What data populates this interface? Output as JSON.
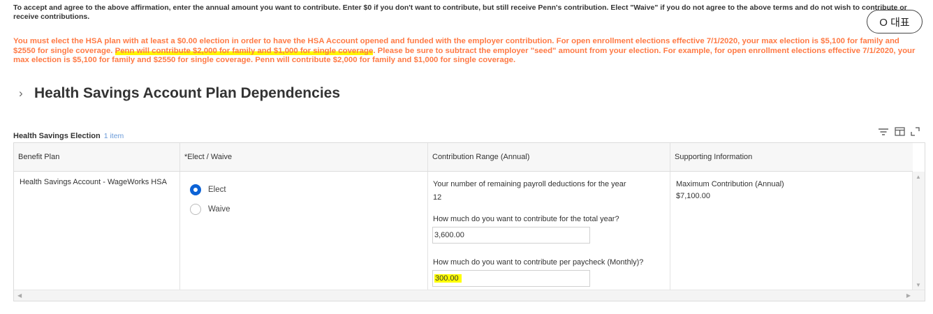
{
  "intro_text": "To accept and agree to the above affirmation, enter the annual amount you want to contribute.  Enter $0 if you don't want to contribute, but still receive Penn's contribution.  Elect \"Waive\" if you do not agree to the above terms and do not wish to contribute or receive contributions.",
  "warning": {
    "part1": "You must elect the HSA plan with at least a $0.00 election in order to have the HSA Account opened and funded with the employer contribution. For open enrollment elections effective 7/1/2020, your max election is $5,100 for family and $2550 for single coverage. ",
    "highlight": "Penn will contribute $2,000 for family and $1,000 for single coverage",
    "part2": ". Please be sure to subtract the employer \"seed\" amount from your election. For example, for open enrollment elections effective 7/1/2020, your max election is $5,100 for family and $2550 for single coverage. Penn will contribute $2,000 for family and $1,000 for single coverage."
  },
  "translate_button": "O 대표",
  "section_title": "Health Savings Account Plan Dependencies",
  "grid": {
    "title": "Health Savings Election",
    "count": "1 item",
    "columns": [
      "Benefit Plan",
      "*Elect / Waive",
      "Contribution Range (Annual)",
      "Supporting Information"
    ],
    "row": {
      "benefit_plan": "Health Savings Account - WageWorks HSA",
      "elect_label": "Elect",
      "waive_label": "Waive",
      "remaining_label": "Your number of remaining payroll deductions for the year",
      "remaining_value": "12",
      "total_question": "How much do you want to contribute for the total year?",
      "total_value": "3,600.00",
      "paycheck_question": "How much do you want to contribute per paycheck (Monthly)?",
      "paycheck_value": "300.00",
      "max_label": "Maximum Contribution (Annual)",
      "max_value": "$7,100.00"
    }
  },
  "colors": {
    "warning": "#ff7a45",
    "highlight": "#ffff00",
    "radio_selected": "#0c63d6",
    "count_link": "#6a9ad8"
  },
  "selected_option": "Elect"
}
